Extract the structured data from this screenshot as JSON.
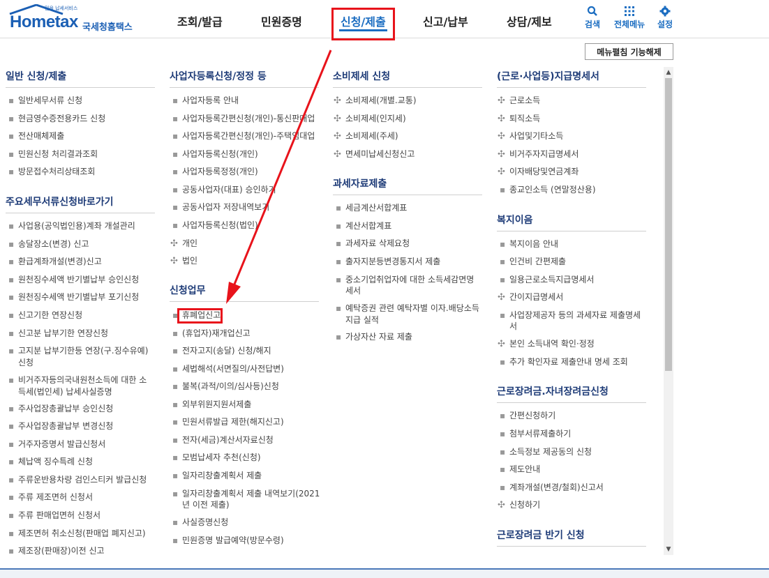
{
  "logo": {
    "brand": "Hometax",
    "tagline": "믿음 납세서비스",
    "org": "국세청홈택스"
  },
  "gnb": [
    {
      "label": "조회/발급",
      "active": false
    },
    {
      "label": "민원증명",
      "active": false
    },
    {
      "label": "신청/제출",
      "active": true
    },
    {
      "label": "신고/납부",
      "active": false
    },
    {
      "label": "상담/제보",
      "active": false
    }
  ],
  "util": {
    "search": "검색",
    "all_menu": "전체메뉴",
    "settings": "설정"
  },
  "edit_button": "메뉴펼침 기능해제",
  "col1": {
    "sec1": {
      "title": "일반 신청/제출",
      "items": [
        "일반세무서류 신청",
        "현금영수증전용카드 신청",
        "전산매체제출",
        "민원신청 처리결과조회",
        "방문접수처리상태조회"
      ]
    },
    "sec2": {
      "title": "주요세무서류신청바로가기",
      "items": [
        "사업용(공익법인용)계좌 개설관리",
        "송달장소(변경) 신고",
        "환급계좌개설(변경)신고",
        "원천징수세액 반기별납부 승인신청",
        "원천징수세액 반기별납부 포기신청",
        "신고기한 연장신청",
        "신고분 납부기한 연장신청",
        "고지분 납부기한등 연장(구.징수유예)",
        "신청",
        "비거주자등의국내원천소득에 대한 소",
        "득세(법인세) 납세사실증명",
        "주사업장총괄납부 승인신청",
        "주사업장총괄납부 변경신청",
        "거주자증명서 발급신청서",
        "체납액 징수특례 신청",
        "주류운반용차량 검인스티커 발급신청",
        "주류 제조면허 신청서",
        "주류 판매업면허 신청서",
        "제조면허 취소신청(판매업 폐지신고)",
        "제조장(판매장)이전 신고"
      ]
    }
  },
  "col2": {
    "sec1": {
      "title": "사업자등록신청/정정 등",
      "items": [
        "사업자등록 안내",
        "사업자등록간편신청(개인)-통신판매업",
        "사업자등록간편신청(개인)-주택임대업",
        "사업자등록신청(개인)",
        "사업자등록정정(개인)",
        "공동사업자(대표) 승인하기",
        "공동사업자 저장내역보기",
        "사업자등록신청(법인)"
      ],
      "plus": [
        "개인",
        "법인"
      ]
    },
    "sec2": {
      "title": "신청업무",
      "items": [
        "휴폐업신고",
        "(휴업자)재개업신고",
        "전자고지(송달) 신청/해지",
        "세법해석(서면질의/사전답변)",
        "불복(과적/이의/심사등)신청",
        "외부위원지원서제출",
        "민원서류발급 제한(해지신고)",
        "전자(세금)계산서자료신청",
        "모범납세자 추천(신청)",
        "일자리창출계획서 제출",
        "일자리창출계획서 제출 내역보기(2021",
        "년 이전 제출)",
        "사실증명신청",
        "민원증명 발급예약(방문수령)"
      ]
    }
  },
  "col3": {
    "sec1": {
      "title": "소비제세 신청",
      "plus": [
        "소비제세(개별.교통)",
        "소비제세(인지세)",
        "소비제세(주세)",
        "면세미납세신청신고"
      ]
    },
    "sec2": {
      "title": "과세자료제출",
      "items": [
        "세금계산서합계표",
        "계산서합계표",
        "과세자료 삭제요청",
        "출자지분등변경통지서 제출",
        "중소기업취업자에 대한 소득세감면명",
        "세서",
        "예탁증권 관련 예탁자별 이자.배당소득",
        "지급 실적",
        "가상자산 자료 제출"
      ]
    }
  },
  "col4": {
    "sec1": {
      "title": "(근로·사업등)지급명세서",
      "plus": [
        "근로소득",
        "퇴직소득",
        "사업및기타소득",
        "비거주자지급명세서",
        "이자배당및연금계좌"
      ],
      "items": [
        "종교인소득 (연말정산용)"
      ]
    },
    "sec2": {
      "title": "복지이음",
      "items": [
        "복지이음 안내",
        "인건비 간편제출",
        "일용근로소득지급명세서"
      ],
      "plus": [
        "간이지급명세서"
      ],
      "items2": [
        "사업장제공자 등의 과세자료 제출명세",
        "서"
      ],
      "plus2": [
        "본인 소득내역 확인·정정"
      ],
      "items3": [
        "추가 확인자료 제출안내 명세 조회"
      ]
    },
    "sec3": {
      "title": "근로장려금.자녀장려금신청",
      "items": [
        "간편신청하기",
        "첨부서류제출하기",
        "소득정보 제공동의 신청",
        "제도안내",
        "계좌개설(변경/철회)신고서"
      ],
      "plus": [
        "신청하기"
      ]
    },
    "sec4": {
      "title": "근로장려금 반기 신청"
    }
  },
  "colors": {
    "accent": "#1b6dc1",
    "highlight": "#e8131b",
    "title": "#1f3c78"
  }
}
